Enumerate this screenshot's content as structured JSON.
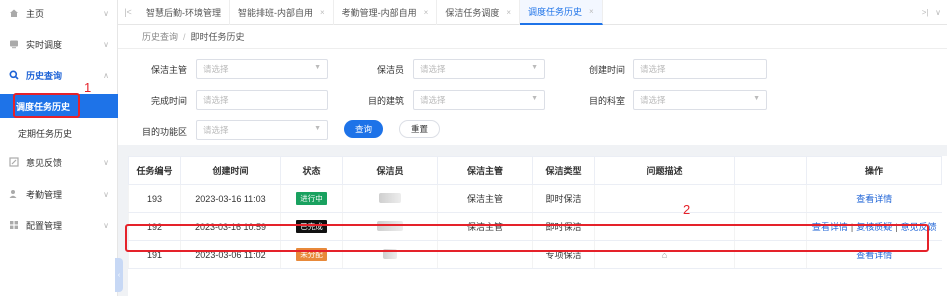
{
  "sidebar": {
    "items": [
      {
        "label": "主页",
        "icon": "home-icon"
      },
      {
        "label": "实时调度",
        "icon": "monitor-icon"
      },
      {
        "label": "历史查询",
        "icon": "search-icon"
      },
      {
        "label": "意见反馈",
        "icon": "edit-icon"
      },
      {
        "label": "考勤管理",
        "icon": "checkin-icon"
      },
      {
        "label": "配置管理",
        "icon": "grid-icon"
      }
    ],
    "sub_items": [
      "调度任务历史",
      "定期任务历史"
    ]
  },
  "tabs": [
    {
      "label": "智慧后勤-环境管理"
    },
    {
      "label": "智能排班-内部自用"
    },
    {
      "label": "考勤管理-内部自用"
    },
    {
      "label": "保洁任务调度"
    },
    {
      "label": "调度任务历史"
    }
  ],
  "breadcrumb": {
    "root": "历史查询",
    "current": "即时任务历史"
  },
  "filters": {
    "supervisor_label": "保洁主管",
    "cleaner_label": "保洁员",
    "created_label": "创建时间",
    "completed_label": "完成时间",
    "building_label": "目的建筑",
    "department_label": "目的科室",
    "function_area_label": "目的功能区",
    "placeholder": "请选择",
    "search_button": "查询",
    "reset_button": "重置"
  },
  "table": {
    "headers": [
      "任务编号",
      "创建时间",
      "状态",
      "保洁员",
      "保洁主管",
      "保洁类型",
      "问题描述",
      "",
      "操作"
    ],
    "rows": [
      {
        "id": "193",
        "created": "2023-03-16 11:03",
        "status": "进行中",
        "status_color": "#19a15f",
        "supervisor": "保洁主管",
        "type": "即时保洁",
        "desc": "",
        "actions": [
          "查看详情"
        ]
      },
      {
        "id": "192",
        "created": "2023-03-16 10:59",
        "status": "已完成",
        "status_color": "#111111",
        "supervisor": "保洁主管",
        "type": "即时保洁",
        "desc": "",
        "actions": [
          "查看详情",
          "复核质疑",
          "意见反馈"
        ]
      },
      {
        "id": "191",
        "created": "2023-03-06 11:02",
        "status": "未分配",
        "status_color": "#e8893a",
        "supervisor": "",
        "type": "专项保洁",
        "desc": "",
        "actions": [
          "查看详情"
        ]
      }
    ]
  },
  "annotations": {
    "label1": "1",
    "label2": "2"
  },
  "colors": {
    "accent": "#1e73e8",
    "annotation": "#e5222a"
  }
}
